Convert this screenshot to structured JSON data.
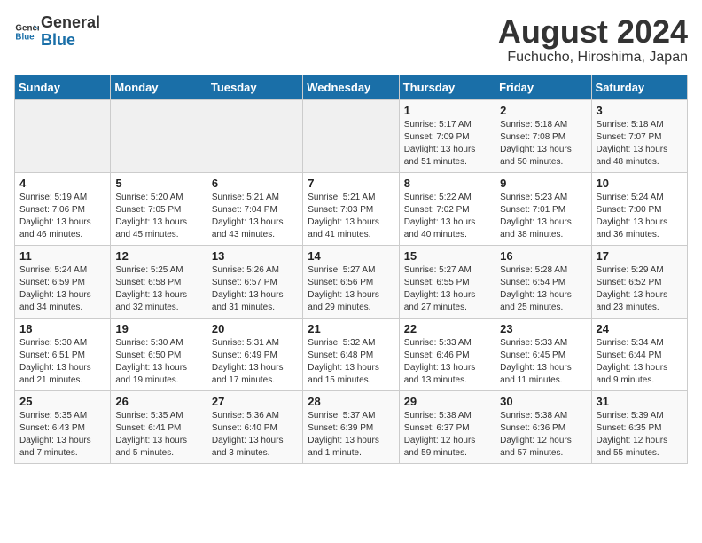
{
  "header": {
    "logo_line1": "General",
    "logo_line2": "Blue",
    "main_title": "August 2024",
    "subtitle": "Fuchucho, Hiroshima, Japan"
  },
  "columns": [
    "Sunday",
    "Monday",
    "Tuesday",
    "Wednesday",
    "Thursday",
    "Friday",
    "Saturday"
  ],
  "weeks": [
    [
      {
        "day": "",
        "info": ""
      },
      {
        "day": "",
        "info": ""
      },
      {
        "day": "",
        "info": ""
      },
      {
        "day": "",
        "info": ""
      },
      {
        "day": "1",
        "info": "Sunrise: 5:17 AM\nSunset: 7:09 PM\nDaylight: 13 hours\nand 51 minutes."
      },
      {
        "day": "2",
        "info": "Sunrise: 5:18 AM\nSunset: 7:08 PM\nDaylight: 13 hours\nand 50 minutes."
      },
      {
        "day": "3",
        "info": "Sunrise: 5:18 AM\nSunset: 7:07 PM\nDaylight: 13 hours\nand 48 minutes."
      }
    ],
    [
      {
        "day": "4",
        "info": "Sunrise: 5:19 AM\nSunset: 7:06 PM\nDaylight: 13 hours\nand 46 minutes."
      },
      {
        "day": "5",
        "info": "Sunrise: 5:20 AM\nSunset: 7:05 PM\nDaylight: 13 hours\nand 45 minutes."
      },
      {
        "day": "6",
        "info": "Sunrise: 5:21 AM\nSunset: 7:04 PM\nDaylight: 13 hours\nand 43 minutes."
      },
      {
        "day": "7",
        "info": "Sunrise: 5:21 AM\nSunset: 7:03 PM\nDaylight: 13 hours\nand 41 minutes."
      },
      {
        "day": "8",
        "info": "Sunrise: 5:22 AM\nSunset: 7:02 PM\nDaylight: 13 hours\nand 40 minutes."
      },
      {
        "day": "9",
        "info": "Sunrise: 5:23 AM\nSunset: 7:01 PM\nDaylight: 13 hours\nand 38 minutes."
      },
      {
        "day": "10",
        "info": "Sunrise: 5:24 AM\nSunset: 7:00 PM\nDaylight: 13 hours\nand 36 minutes."
      }
    ],
    [
      {
        "day": "11",
        "info": "Sunrise: 5:24 AM\nSunset: 6:59 PM\nDaylight: 13 hours\nand 34 minutes."
      },
      {
        "day": "12",
        "info": "Sunrise: 5:25 AM\nSunset: 6:58 PM\nDaylight: 13 hours\nand 32 minutes."
      },
      {
        "day": "13",
        "info": "Sunrise: 5:26 AM\nSunset: 6:57 PM\nDaylight: 13 hours\nand 31 minutes."
      },
      {
        "day": "14",
        "info": "Sunrise: 5:27 AM\nSunset: 6:56 PM\nDaylight: 13 hours\nand 29 minutes."
      },
      {
        "day": "15",
        "info": "Sunrise: 5:27 AM\nSunset: 6:55 PM\nDaylight: 13 hours\nand 27 minutes."
      },
      {
        "day": "16",
        "info": "Sunrise: 5:28 AM\nSunset: 6:54 PM\nDaylight: 13 hours\nand 25 minutes."
      },
      {
        "day": "17",
        "info": "Sunrise: 5:29 AM\nSunset: 6:52 PM\nDaylight: 13 hours\nand 23 minutes."
      }
    ],
    [
      {
        "day": "18",
        "info": "Sunrise: 5:30 AM\nSunset: 6:51 PM\nDaylight: 13 hours\nand 21 minutes."
      },
      {
        "day": "19",
        "info": "Sunrise: 5:30 AM\nSunset: 6:50 PM\nDaylight: 13 hours\nand 19 minutes."
      },
      {
        "day": "20",
        "info": "Sunrise: 5:31 AM\nSunset: 6:49 PM\nDaylight: 13 hours\nand 17 minutes."
      },
      {
        "day": "21",
        "info": "Sunrise: 5:32 AM\nSunset: 6:48 PM\nDaylight: 13 hours\nand 15 minutes."
      },
      {
        "day": "22",
        "info": "Sunrise: 5:33 AM\nSunset: 6:46 PM\nDaylight: 13 hours\nand 13 minutes."
      },
      {
        "day": "23",
        "info": "Sunrise: 5:33 AM\nSunset: 6:45 PM\nDaylight: 13 hours\nand 11 minutes."
      },
      {
        "day": "24",
        "info": "Sunrise: 5:34 AM\nSunset: 6:44 PM\nDaylight: 13 hours\nand 9 minutes."
      }
    ],
    [
      {
        "day": "25",
        "info": "Sunrise: 5:35 AM\nSunset: 6:43 PM\nDaylight: 13 hours\nand 7 minutes."
      },
      {
        "day": "26",
        "info": "Sunrise: 5:35 AM\nSunset: 6:41 PM\nDaylight: 13 hours\nand 5 minutes."
      },
      {
        "day": "27",
        "info": "Sunrise: 5:36 AM\nSunset: 6:40 PM\nDaylight: 13 hours\nand 3 minutes."
      },
      {
        "day": "28",
        "info": "Sunrise: 5:37 AM\nSunset: 6:39 PM\nDaylight: 13 hours\nand 1 minute."
      },
      {
        "day": "29",
        "info": "Sunrise: 5:38 AM\nSunset: 6:37 PM\nDaylight: 12 hours\nand 59 minutes."
      },
      {
        "day": "30",
        "info": "Sunrise: 5:38 AM\nSunset: 6:36 PM\nDaylight: 12 hours\nand 57 minutes."
      },
      {
        "day": "31",
        "info": "Sunrise: 5:39 AM\nSunset: 6:35 PM\nDaylight: 12 hours\nand 55 minutes."
      }
    ]
  ]
}
